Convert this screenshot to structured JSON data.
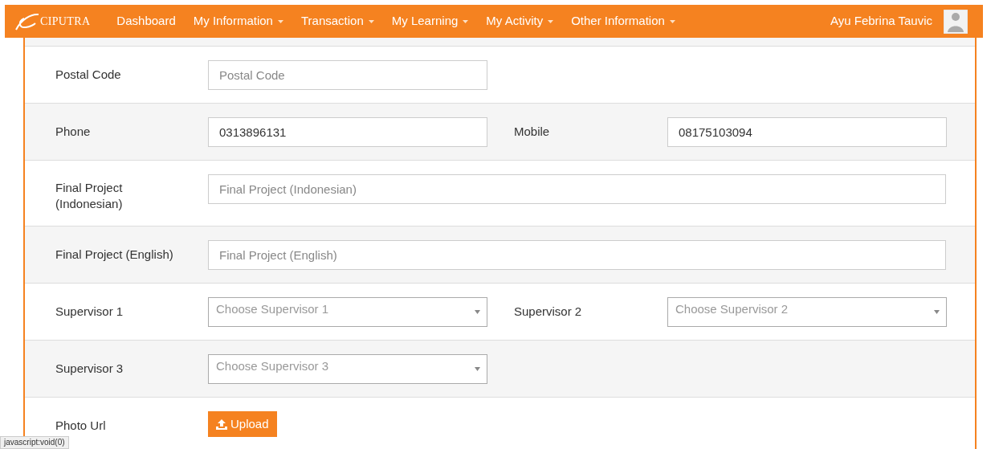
{
  "navbar": {
    "brand": "CIPUTRA",
    "menu": [
      {
        "label": "Dashboard",
        "dropdown": false
      },
      {
        "label": "My Information",
        "dropdown": true
      },
      {
        "label": "Transaction",
        "dropdown": true
      },
      {
        "label": "My Learning",
        "dropdown": true
      },
      {
        "label": "My Activity",
        "dropdown": true
      },
      {
        "label": "Other Information",
        "dropdown": true
      }
    ],
    "user": "Ayu Febrina Tauvic"
  },
  "form_rows": [
    {
      "fields": [
        {
          "kind": "text",
          "label": "Postal Code",
          "placeholder": "Postal Code"
        }
      ]
    },
    {
      "fields": [
        {
          "kind": "text",
          "label": "Phone",
          "value": "0313896131"
        },
        {
          "kind": "text",
          "label": "Mobile",
          "value": "08175103094"
        }
      ]
    },
    {
      "fields": [
        {
          "kind": "wide",
          "label": "Final Project (Indonesian)",
          "placeholder": "Final Project (Indonesian)"
        }
      ]
    },
    {
      "fields": [
        {
          "kind": "wide",
          "label": "Final Project (English)",
          "placeholder": "Final Project (English)"
        }
      ]
    },
    {
      "fields": [
        {
          "kind": "select",
          "label": "Supervisor 1",
          "placeholder": "Choose Supervisor 1"
        },
        {
          "kind": "select",
          "label": "Supervisor 2",
          "placeholder": "Choose Supervisor 2"
        }
      ]
    },
    {
      "fields": [
        {
          "kind": "select",
          "label": "Supervisor 3",
          "placeholder": "Choose Supervisor 3"
        }
      ]
    },
    {
      "fields": [
        {
          "kind": "upload",
          "label": "Photo Url",
          "button": "Upload"
        }
      ]
    }
  ],
  "status_bar": "javascript:void(0)"
}
